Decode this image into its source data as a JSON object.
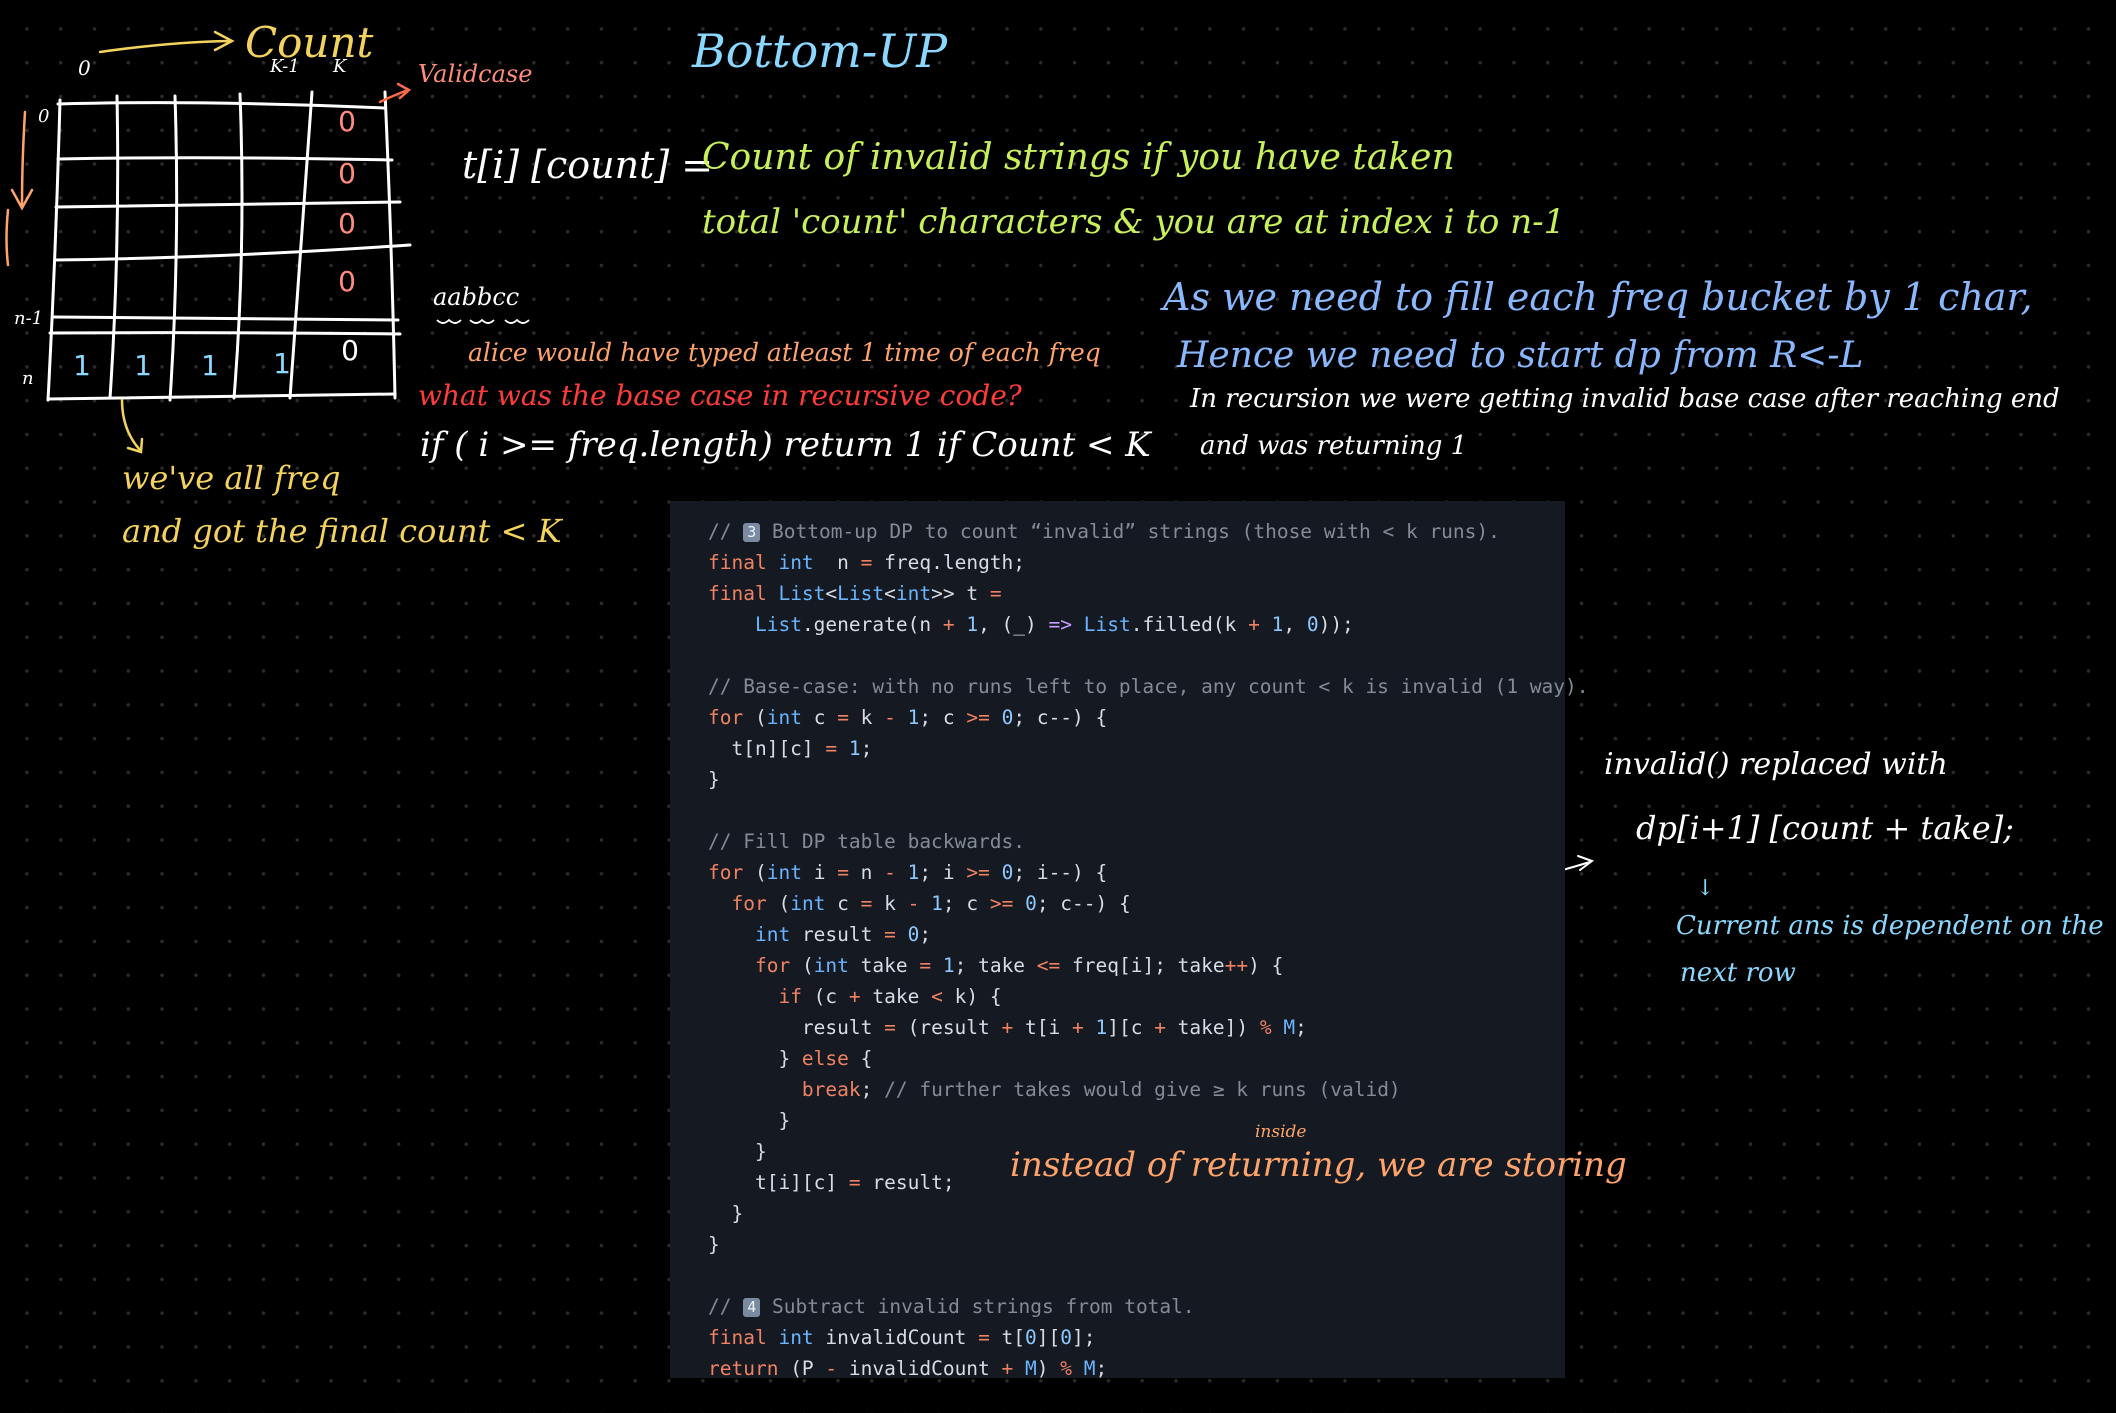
{
  "sketch": {
    "count_label": "Count",
    "col_zero": "0",
    "col_k_minus_1": "K-1",
    "col_k": "K",
    "valid_case": "Validcase",
    "row_zero": "0",
    "row_n_minus_1": "n-1",
    "row_n": "n",
    "last_col_values": [
      "0",
      "0",
      "0",
      "0",
      "0"
    ],
    "bottom_row_values": [
      "1",
      "1",
      "1",
      "1",
      "0"
    ],
    "note_line1": "we've all freq",
    "note_line2": "and got the final count < K"
  },
  "title": "Bottom-UP",
  "definition": {
    "lhs": "t[i] [count] =",
    "line1": "Count of invalid strings if you have taken",
    "line2": "total 'count' characters & you are at index i to n-1"
  },
  "base_case": {
    "example": "aabbcc",
    "alice_note": "alice would have typed atleast 1 time of each freq",
    "question": "what was the base case in recursive code?",
    "code": "if ( i >= freq.length) return 1 if Count < K"
  },
  "right_note": {
    "line1": "As we need to fill each freq bucket by 1 char,",
    "line2": "Hence we need to start dp from R<-L",
    "line3": "In recursion we were getting invalid base case after reaching end",
    "line4": "and was returning 1"
  },
  "replace_note": {
    "line1": "invalid() replaced with",
    "line2": "dp[i+1] [count + take];",
    "arrow": "↓",
    "line3": "Current ans is dependent on the",
    "line4": "next row"
  },
  "storing_note": {
    "text": "instead of returning, we are storing",
    "insert": "inside"
  },
  "code_lines": [
    [
      [
        "cm",
        "// "
      ],
      [
        "emoji",
        "3"
      ],
      [
        "cm",
        " Bottom-up DP to count “invalid” strings (those with < k runs)."
      ]
    ],
    [
      [
        "kw",
        "final "
      ],
      [
        "ty",
        "int"
      ],
      [
        "",
        "  n "
      ],
      [
        "op",
        "="
      ],
      [
        "",
        " freq.length;"
      ]
    ],
    [
      [
        "kw",
        "final "
      ],
      [
        "ty",
        "List"
      ],
      [
        "",
        "<"
      ],
      [
        "ty",
        "List"
      ],
      [
        "",
        "<"
      ],
      [
        "ty",
        "int"
      ],
      [
        "",
        ">> t "
      ],
      [
        "op",
        "="
      ]
    ],
    [
      [
        "",
        "    "
      ],
      [
        "ty",
        "List"
      ],
      [
        "",
        ".generate(n "
      ],
      [
        "op",
        "+"
      ],
      [
        "num",
        " 1"
      ],
      [
        "",
        ", (_) "
      ],
      [
        "ar",
        "=>"
      ],
      [
        "ty",
        " List"
      ],
      [
        "",
        ".filled(k "
      ],
      [
        "op",
        "+"
      ],
      [
        "num",
        " 1"
      ],
      [
        "",
        ", "
      ],
      [
        "num",
        "0"
      ],
      [
        "",
        "));"
      ]
    ],
    [],
    [
      [
        "cm",
        "// Base-case: with no runs left to place, any count < k is invalid (1 way)."
      ]
    ],
    [
      [
        "kw",
        "for"
      ],
      [
        "",
        " ("
      ],
      [
        "ty",
        "int"
      ],
      [
        "",
        " c "
      ],
      [
        "op",
        "="
      ],
      [
        "",
        " k "
      ],
      [
        "op",
        "-"
      ],
      [
        "num",
        " 1"
      ],
      [
        "",
        "; c "
      ],
      [
        "op",
        ">="
      ],
      [
        "num",
        " 0"
      ],
      [
        "",
        "; c--) {"
      ]
    ],
    [
      [
        "",
        "  t[n][c] "
      ],
      [
        "op",
        "="
      ],
      [
        "num",
        " 1"
      ],
      [
        "",
        ";"
      ]
    ],
    [
      [
        "",
        "}"
      ]
    ],
    [],
    [
      [
        "cm",
        "// Fill DP table backwards."
      ]
    ],
    [
      [
        "kw",
        "for"
      ],
      [
        "",
        " ("
      ],
      [
        "ty",
        "int"
      ],
      [
        "",
        " i "
      ],
      [
        "op",
        "="
      ],
      [
        "",
        " n "
      ],
      [
        "op",
        "-"
      ],
      [
        "num",
        " 1"
      ],
      [
        "",
        "; i "
      ],
      [
        "op",
        ">="
      ],
      [
        "num",
        " 0"
      ],
      [
        "",
        "; i--) {"
      ]
    ],
    [
      [
        "",
        "  "
      ],
      [
        "kw",
        "for"
      ],
      [
        "",
        " ("
      ],
      [
        "ty",
        "int"
      ],
      [
        "",
        " c "
      ],
      [
        "op",
        "="
      ],
      [
        "",
        " k "
      ],
      [
        "op",
        "-"
      ],
      [
        "num",
        " 1"
      ],
      [
        "",
        "; c "
      ],
      [
        "op",
        ">="
      ],
      [
        "num",
        " 0"
      ],
      [
        "",
        "; c--) {"
      ]
    ],
    [
      [
        "",
        "    "
      ],
      [
        "ty",
        "int"
      ],
      [
        "",
        " result "
      ],
      [
        "op",
        "="
      ],
      [
        "num",
        " 0"
      ],
      [
        "",
        ";"
      ]
    ],
    [
      [
        "",
        "    "
      ],
      [
        "kw",
        "for"
      ],
      [
        "",
        " ("
      ],
      [
        "ty",
        "int"
      ],
      [
        "",
        " take "
      ],
      [
        "op",
        "="
      ],
      [
        "num",
        " 1"
      ],
      [
        "",
        "; take "
      ],
      [
        "op",
        "<="
      ],
      [
        "",
        " freq[i]; take"
      ],
      [
        "op",
        "++"
      ],
      [
        "",
        ") {"
      ]
    ],
    [
      [
        "",
        "      "
      ],
      [
        "kw",
        "if"
      ],
      [
        "",
        " (c "
      ],
      [
        "op",
        "+"
      ],
      [
        "",
        " take "
      ],
      [
        "op",
        "<"
      ],
      [
        "",
        " k) {"
      ]
    ],
    [
      [
        "",
        "        result "
      ],
      [
        "op",
        "="
      ],
      [
        "",
        " (result "
      ],
      [
        "op",
        "+"
      ],
      [
        "",
        " t[i "
      ],
      [
        "op",
        "+"
      ],
      [
        "num",
        " 1"
      ],
      [
        "",
        "][c "
      ],
      [
        "op",
        "+"
      ],
      [
        "",
        " take]) "
      ],
      [
        "op",
        "%"
      ],
      [
        "ty",
        " M"
      ],
      [
        "",
        ";"
      ]
    ],
    [
      [
        "",
        "      } "
      ],
      [
        "kw",
        "else"
      ],
      [
        "",
        " {"
      ]
    ],
    [
      [
        "",
        "        "
      ],
      [
        "kw",
        "break"
      ],
      [
        "",
        "; "
      ],
      [
        "cm",
        "// further takes would give ≥ k runs (valid)"
      ]
    ],
    [
      [
        "",
        "      }"
      ]
    ],
    [
      [
        "",
        "    }"
      ]
    ],
    [
      [
        "",
        "    t[i][c] "
      ],
      [
        "op",
        "="
      ],
      [
        "",
        " result;"
      ]
    ],
    [
      [
        "",
        "  }"
      ]
    ],
    [
      [
        "",
        "}"
      ]
    ],
    [],
    [
      [
        "cm",
        "// "
      ],
      [
        "emoji",
        "4"
      ],
      [
        "cm",
        " Subtract invalid strings from total."
      ]
    ],
    [
      [
        "kw",
        "final "
      ],
      [
        "ty",
        "int"
      ],
      [
        "",
        " invalidCount "
      ],
      [
        "op",
        "="
      ],
      [
        "",
        " t["
      ],
      [
        "num",
        "0"
      ],
      [
        "",
        "]["
      ],
      [
        "num",
        "0"
      ],
      [
        "",
        "];"
      ]
    ],
    [
      [
        "kw",
        "return"
      ],
      [
        "",
        " (P "
      ],
      [
        "op",
        "-"
      ],
      [
        "",
        " invalidCount "
      ],
      [
        "op",
        "+"
      ],
      [
        "ty",
        " M"
      ],
      [
        "",
        ") "
      ],
      [
        "op",
        "%"
      ],
      [
        "ty",
        " M"
      ],
      [
        "",
        ";"
      ]
    ]
  ]
}
